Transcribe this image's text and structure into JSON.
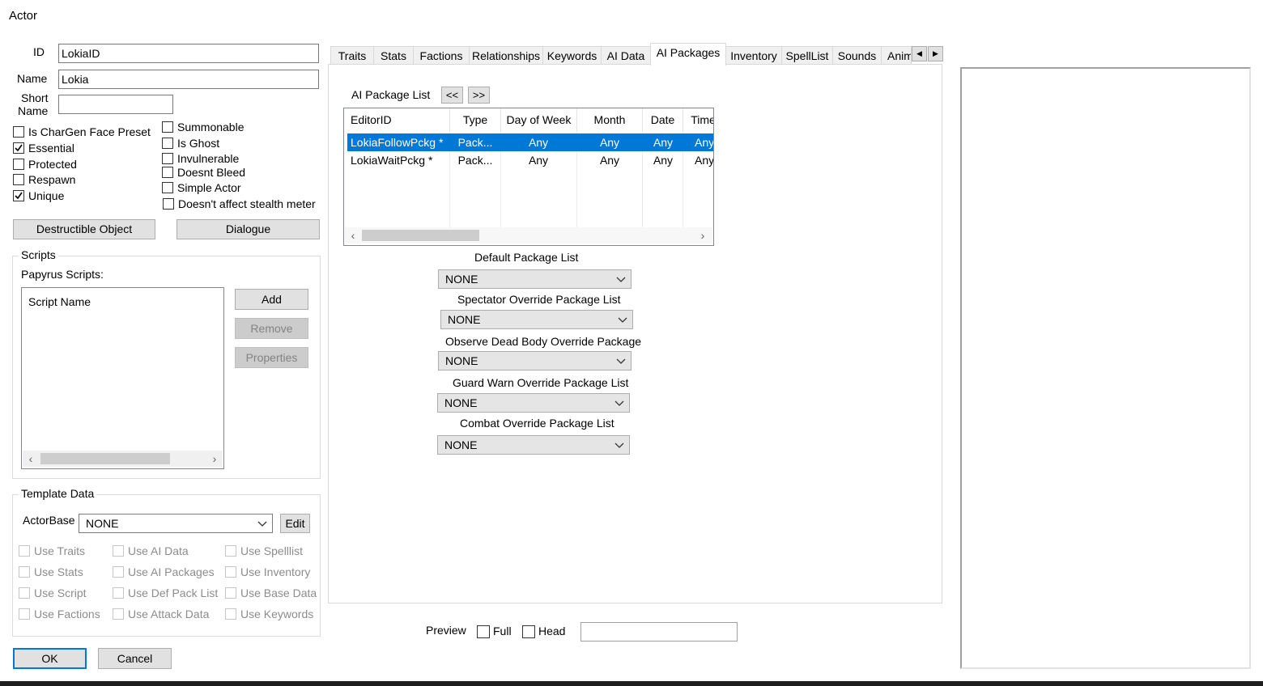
{
  "window": {
    "title": "Actor"
  },
  "fields": {
    "id_label": "ID",
    "id_value": "LokiaID",
    "name_label": "Name",
    "name_value": "Lokia",
    "short_name_label_1": "Short",
    "short_name_label_2": "Name",
    "short_name_value": ""
  },
  "flags_left": [
    {
      "label": "Is CharGen Face Preset",
      "checked": false
    },
    {
      "label": "Essential",
      "checked": true
    },
    {
      "label": "Protected",
      "checked": false
    },
    {
      "label": "Respawn",
      "checked": false
    },
    {
      "label": "Unique",
      "checked": true
    }
  ],
  "flags_right": [
    {
      "label": "Summonable",
      "checked": false
    },
    {
      "label": "Is Ghost",
      "checked": false
    },
    {
      "label": "Invulnerable",
      "checked": false
    },
    {
      "label": "Doesnt Bleed",
      "checked": false
    },
    {
      "label": "Simple Actor",
      "checked": false
    },
    {
      "label": "Doesn't affect stealth meter",
      "checked": false
    }
  ],
  "buttons": {
    "destructible": "Destructible Object",
    "dialogue": "Dialogue",
    "add": "Add",
    "remove": "Remove",
    "properties": "Properties",
    "edit": "Edit",
    "ok": "OK",
    "cancel": "Cancel",
    "prev": "<<",
    "next": ">>"
  },
  "scripts": {
    "group_title": "Scripts",
    "papyrus_label": "Papyrus Scripts:",
    "column": "Script Name"
  },
  "template": {
    "group_title": "Template Data",
    "actorbase_label": "ActorBase",
    "actorbase_value": "NONE",
    "options": [
      [
        "Use Traits",
        "Use AI Data",
        "Use Spelllist"
      ],
      [
        "Use Stats",
        "Use AI Packages",
        "Use Inventory"
      ],
      [
        "Use Script",
        "Use Def Pack List",
        "Use Base Data"
      ],
      [
        "Use Factions",
        "Use Attack Data",
        "Use Keywords"
      ]
    ]
  },
  "tabs": [
    "Traits",
    "Stats",
    "Factions",
    "Relationships",
    "Keywords",
    "AI Data",
    "AI Packages",
    "Inventory",
    "SpellList",
    "Sounds",
    "Anim"
  ],
  "active_tab": "AI Packages",
  "ai_packages": {
    "list_label": "AI Package List",
    "columns": [
      "EditorID",
      "Type",
      "Day of Week",
      "Month",
      "Date",
      "Time"
    ],
    "rows": [
      {
        "editor_id": "LokiaFollowPckg *",
        "type": "Pack...",
        "day": "Any",
        "month": "Any",
        "date": "Any",
        "time": "Any",
        "selected": true
      },
      {
        "editor_id": "LokiaWaitPckg *",
        "type": "Pack...",
        "day": "Any",
        "month": "Any",
        "date": "Any",
        "time": "Any",
        "selected": false
      }
    ],
    "lists": [
      {
        "label": "Default Package List",
        "value": "NONE"
      },
      {
        "label": "Spectator Override Package List",
        "value": "NONE"
      },
      {
        "label": "Observe Dead Body Override Package",
        "value": "NONE"
      },
      {
        "label": "Guard Warn Override Package List",
        "value": "NONE"
      },
      {
        "label": "Combat Override Package List",
        "value": "NONE"
      }
    ]
  },
  "preview": {
    "label": "Preview",
    "full_label": "Full",
    "head_label": "Head",
    "value": ""
  },
  "colors": {
    "selection": "#0078d7",
    "accent": "#0078d7"
  }
}
